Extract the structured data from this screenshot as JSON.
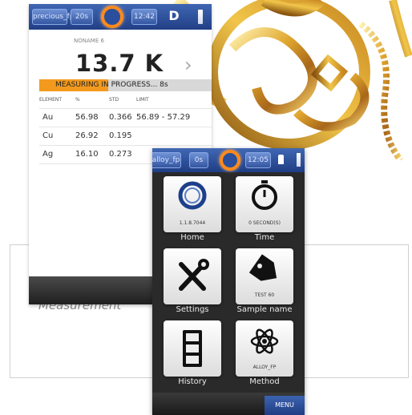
{
  "caption": "Measurement",
  "phone_front": {
    "status": {
      "preset": "precious_fp",
      "timer": "20s",
      "clock": "12:42",
      "letter": "D"
    },
    "sample_name": "NONAME 6",
    "thickness": "13.7 K",
    "progress_text": "MEASURING IN PROGRESS... 8s",
    "progress_fraction": 0.4,
    "columns": [
      "ELEMENT",
      "%",
      "STD",
      "LIMIT"
    ],
    "rows": [
      {
        "element": "Au",
        "percent": "56.98",
        "std": "0.366",
        "limit": "56.89 - 57.29"
      },
      {
        "element": "Cu",
        "percent": "26.92",
        "std": "0.195",
        "limit": ""
      },
      {
        "element": "Ag",
        "percent": "16.10",
        "std": "0.273",
        "limit": ""
      }
    ]
  },
  "phone_menu": {
    "status": {
      "preset": "alloy_fp",
      "timer": "0s",
      "clock": "12:05"
    },
    "tiles": [
      {
        "label": "Home",
        "sub": "1.1.8.7044",
        "icon": "ring-logo-icon"
      },
      {
        "label": "Time",
        "sub": "0 SECOND(S)",
        "icon": "stopwatch-icon"
      },
      {
        "label": "Settings",
        "sub": "",
        "icon": "tools-icon"
      },
      {
        "label": "Sample name",
        "sub": "TEST 60",
        "icon": "tag-icon"
      },
      {
        "label": "History",
        "sub": "",
        "icon": "cabinet-icon"
      },
      {
        "label": "Method",
        "sub": "ALLOY_FP",
        "icon": "atom-icon"
      }
    ],
    "menu_label": "MENU"
  },
  "colors": {
    "accent": "#f39a1e",
    "bar_blue": "#2b4f9c"
  }
}
